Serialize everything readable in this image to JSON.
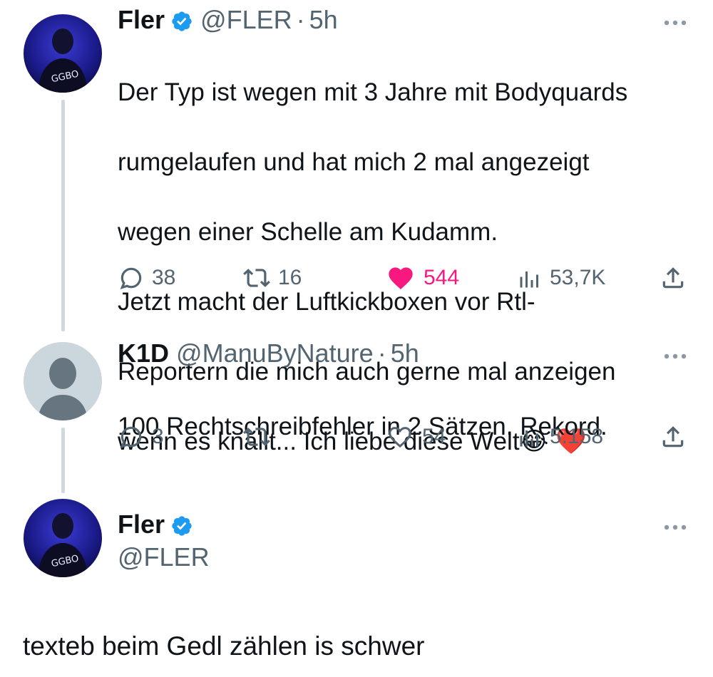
{
  "tweets": [
    {
      "name": "Fler",
      "handle": "@FLER",
      "dot": "·",
      "time": "5h",
      "lines": [
        "Der Typ ist wegen mit 3 Jahre mit Bodyquards",
        "rumgelaufen und hat mich 2 mal angezeigt",
        "wegen einer Schelle am Kudamm.",
        "Jetzt macht der Luftkickboxen vor Rtl-",
        "Reportern die mich auch gerne mal anzeigen",
        "wenn es knallt... Ich liebe diese Welt😂 ❤️"
      ],
      "replies": "38",
      "reposts": "16",
      "likes": "544",
      "liked": true,
      "views": "53,7K"
    },
    {
      "name": "K1D",
      "handle": "@ManuByNature",
      "dot": "·",
      "time": "5h",
      "lines": [
        "100 Rechtschreibfehler in 2 Sätzen. Rekord."
      ],
      "replies": "3",
      "reposts": "",
      "likes": "54",
      "liked": false,
      "views": "5.158"
    },
    {
      "name": "Fler",
      "handle": "@FLER"
    }
  ],
  "reply_body": "texteb beim Gedl zählen is schwer",
  "colors": {
    "text": "#0f1419",
    "muted": "#536471",
    "like": "#f91880",
    "verified": "#1d9bf0",
    "thread_line": "#cfd9de"
  },
  "icons": [
    "verified-badge-icon",
    "more-options-icon",
    "reply-icon",
    "repost-icon",
    "like-icon",
    "views-icon",
    "share-icon",
    "default-avatar-icon"
  ]
}
